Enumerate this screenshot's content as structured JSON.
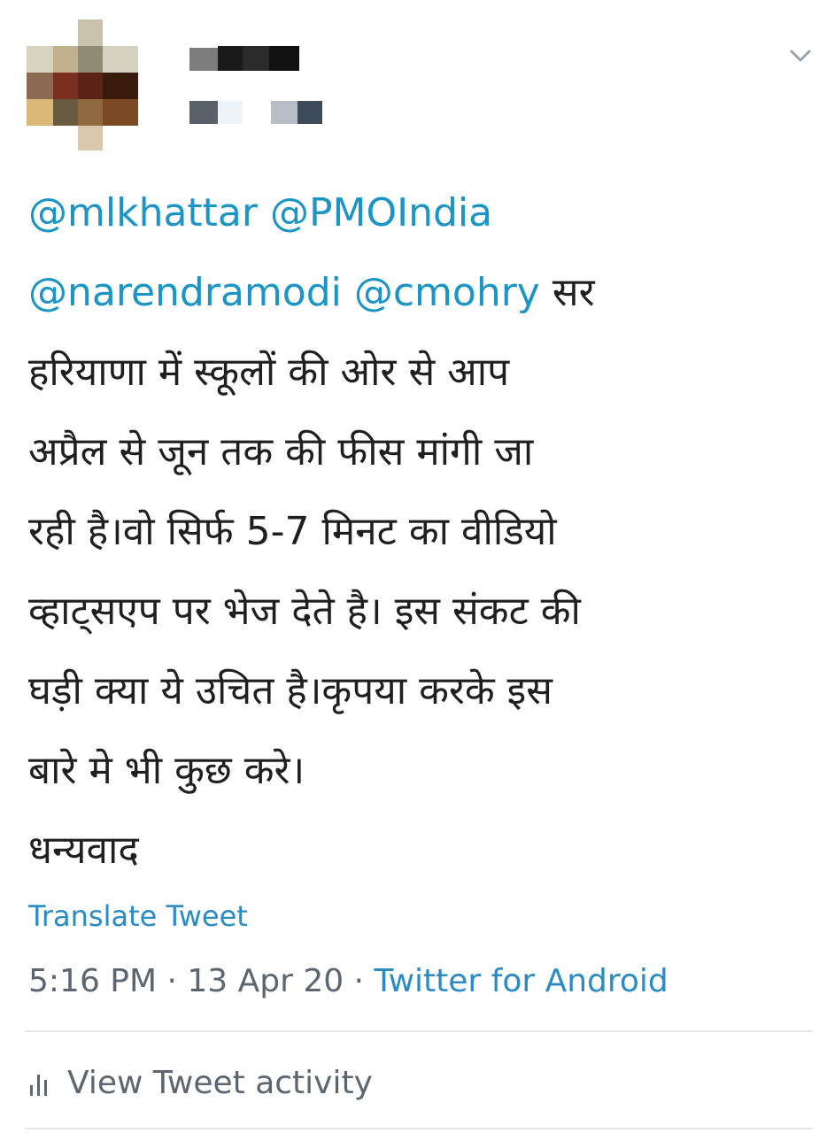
{
  "tweet": {
    "lines": [
      {
        "parts": [
          {
            "text": "@mlkhattar",
            "type": "mention"
          },
          {
            "text": " ",
            "type": "text"
          },
          {
            "text": "@PMOIndia",
            "type": "mention"
          }
        ]
      },
      {
        "parts": [
          {
            "text": "@narendramodi",
            "type": "mention"
          },
          {
            "text": " ",
            "type": "text"
          },
          {
            "text": "@cmohry",
            "type": "mention"
          },
          {
            "text": " सर",
            "type": "text"
          }
        ]
      },
      {
        "parts": [
          {
            "text": "हरियाणा में स्कूलों की ओर से आप",
            "type": "text"
          }
        ]
      },
      {
        "parts": [
          {
            "text": "अप्रैल से जून तक की फीस मांगी जा",
            "type": "text"
          }
        ]
      },
      {
        "parts": [
          {
            "text": "रही है।वो सिर्फ 5-7 मिनट का वीडियो",
            "type": "text"
          }
        ]
      },
      {
        "parts": [
          {
            "text": "व्हाट्सएप पर भेज देते है। इस संकट की",
            "type": "text"
          }
        ]
      },
      {
        "parts": [
          {
            "text": "घड़ी क्या ये उचित है।कृपया करके इस",
            "type": "text"
          }
        ]
      },
      {
        "parts": [
          {
            "text": "बारे मे भी कुछ करे।",
            "type": "text"
          }
        ]
      },
      {
        "parts": [
          {
            "text": "धन्यवाद",
            "type": "text"
          }
        ]
      }
    ],
    "translate_label": "Translate Tweet",
    "time": "5:16 PM",
    "separator": " · ",
    "date": "13 Apr 20",
    "source": "Twitter for Android",
    "activity_label": "View Tweet activity"
  },
  "colors": {
    "link": "#1b95c8",
    "meta": "#5b6670",
    "text": "#1f1f1f"
  },
  "icons": {
    "menu": "chevron-down-icon",
    "activity": "bar-chart-icon"
  }
}
